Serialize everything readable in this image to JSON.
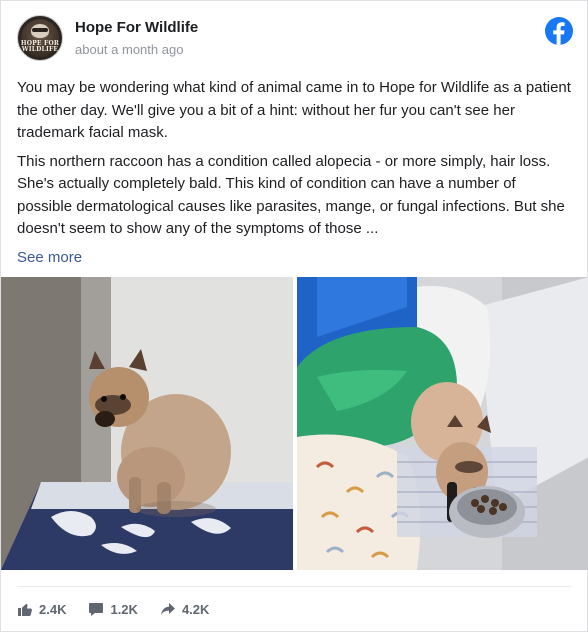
{
  "post": {
    "page_name": "Hope For Wildlife",
    "avatar_text": "HOPE FOR WILDLIFE",
    "timestamp": "about a month ago",
    "paragraph_1": "You may be wondering what kind of animal came in to Hope for Wildlife as a patient the other day. We'll give you a bit of a hint: without her fur you can't see her trademark facial mask.",
    "paragraph_2": "This northern raccoon has a condition called alopecia - or more simply, hair loss. She's actually completely bald. This kind of condition can have a number of possible dermatological causes like parasites, mange, or fungal infections. But she doesn't seem to show any of the symptoms of those ...",
    "see_more": "See more"
  },
  "photos": [
    {
      "icon": "photo-hairless-raccoon-in-corner"
    },
    {
      "icon": "photo-hairless-raccoon-eating"
    }
  ],
  "stats": {
    "likes": "2.4K",
    "comments": "1.2K",
    "shares": "4.2K"
  },
  "colors": {
    "facebook_blue": "#1877f2",
    "link_blue": "#385898",
    "meta_gray": "#606770"
  }
}
